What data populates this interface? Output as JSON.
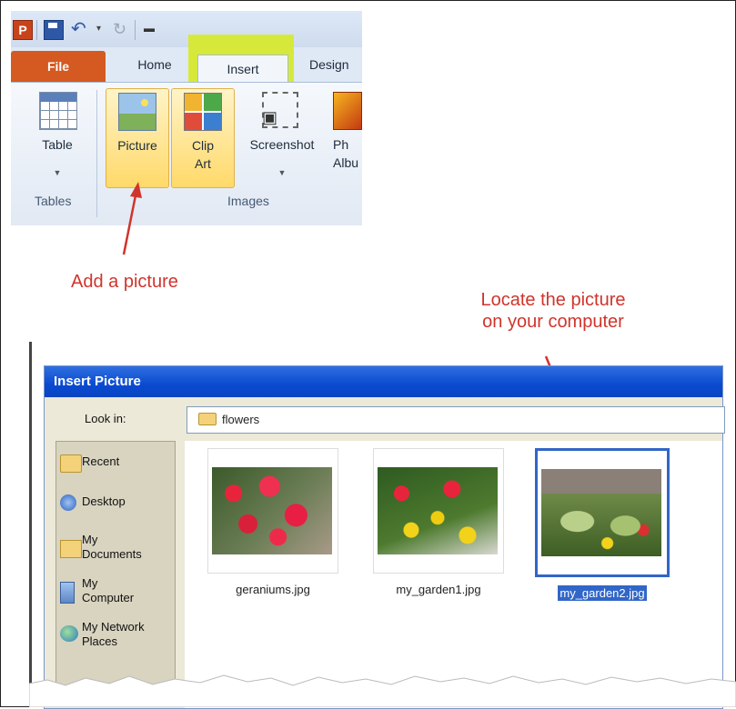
{
  "ribbon": {
    "app_logo": "P",
    "qat_icons": [
      "save-icon",
      "undo-icon",
      "redo-icon",
      "customize-qat-icon"
    ],
    "tabs": [
      {
        "label": "File"
      },
      {
        "label": "Home"
      },
      {
        "label": "Insert"
      },
      {
        "label": "Design"
      }
    ],
    "commands": {
      "table": "Table",
      "picture": "Picture",
      "clipart_line1": "Clip",
      "clipart_line2": "Art",
      "screenshot": "Screenshot",
      "album_line1": "Ph",
      "album_line2": "Albu"
    },
    "groups": {
      "tables": "Tables",
      "images": "Images"
    },
    "highlight_color": "#d6e93a"
  },
  "annotations": {
    "add_picture": "Add a picture",
    "locate_line1": "Locate the picture",
    "locate_line2": "on your computer",
    "color": "#d0342c"
  },
  "dialog": {
    "title": "Insert Picture",
    "look_in_label": "Look in:",
    "look_in_value": "flowers",
    "places": [
      {
        "label_line1": "Recent",
        "label_line2": ""
      },
      {
        "label_line1": "Desktop",
        "label_line2": ""
      },
      {
        "label_line1": "My",
        "label_line2": "Documents"
      },
      {
        "label_line1": "My",
        "label_line2": "Computer"
      },
      {
        "label_line1": "My Network",
        "label_line2": "Places"
      }
    ],
    "files": [
      {
        "name": "geraniums.jpg",
        "selected": false
      },
      {
        "name": "my_garden1.jpg",
        "selected": false
      },
      {
        "name": "my_garden2.jpg",
        "selected": true
      }
    ]
  }
}
